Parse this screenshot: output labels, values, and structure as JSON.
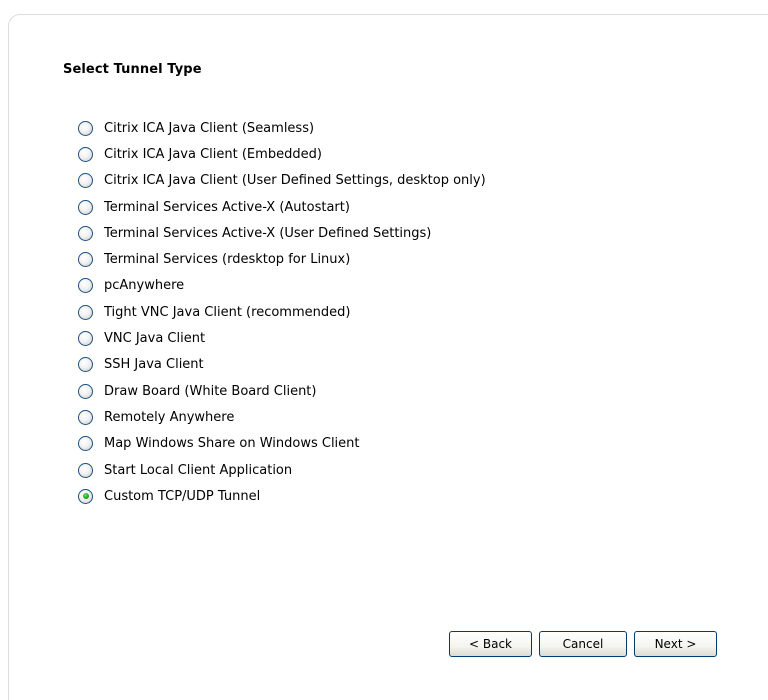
{
  "title": "Select Tunnel Type",
  "options": [
    {
      "label": "Citrix ICA Java Client (Seamless)",
      "checked": false
    },
    {
      "label": "Citrix ICA Java Client (Embedded)",
      "checked": false
    },
    {
      "label": "Citrix ICA Java Client (User Defined Settings, desktop only)",
      "checked": false
    },
    {
      "label": "Terminal Services Active-X (Autostart)",
      "checked": false
    },
    {
      "label": "Terminal Services Active-X (User Defined Settings)",
      "checked": false
    },
    {
      "label": "Terminal Services (rdesktop for Linux)",
      "checked": false
    },
    {
      "label": "pcAnywhere",
      "checked": false
    },
    {
      "label": "Tight VNC Java Client (recommended)",
      "checked": false
    },
    {
      "label": "VNC Java Client",
      "checked": false
    },
    {
      "label": "SSH Java Client",
      "checked": false
    },
    {
      "label": "Draw Board (White Board Client)",
      "checked": false
    },
    {
      "label": "Remotely Anywhere",
      "checked": false
    },
    {
      "label": "Map Windows Share on Windows Client",
      "checked": false
    },
    {
      "label": "Start Local Client Application",
      "checked": false
    },
    {
      "label": "Custom TCP/UDP Tunnel",
      "checked": true
    }
  ],
  "buttons": {
    "back": "< Back",
    "cancel": "Cancel",
    "next": "Next >"
  }
}
